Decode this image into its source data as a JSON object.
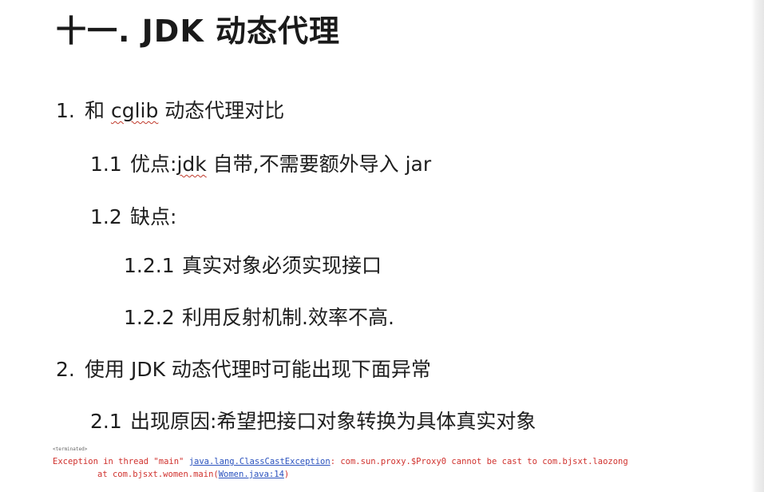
{
  "title": "十一. JDK 动态代理",
  "items": [
    {
      "num": "1.",
      "text_pre": "和 ",
      "text_squiggle": "cglib",
      "text_post": " 动态代理对比"
    },
    {
      "num": "1.1",
      "text_pre": "优点:",
      "text_squiggle": "jdk",
      "text_post": " 自带,不需要额外导入 jar"
    },
    {
      "num": "1.2",
      "text": "缺点:"
    },
    {
      "num": "1.2.1",
      "text": "真实对象必须实现接口"
    },
    {
      "num": "1.2.2",
      "text": "利用反射机制.效率不高."
    },
    {
      "num": "2.",
      "text": "使用 JDK 动态代理时可能出现下面异常"
    },
    {
      "num": "2.1",
      "text": "出现原因:希望把接口对象转换为具体真实对象"
    }
  ],
  "console": {
    "tiny_label": "&lt;terminated&gt;",
    "error_prefix": "Exception in thread \"main\" ",
    "exception_class": "java.lang.ClassCastException",
    "error_suffix": ": com.sun.proxy.$Proxy0 cannot be cast to com.bjsxt.laozong",
    "trace_prefix": "at com.bjsxt.women.main(",
    "trace_link": "Women.java:14",
    "trace_suffix": ")"
  },
  "colors": {
    "text": "#1e1e1e",
    "error_red": "#d0312d",
    "link_blue": "#2a52be",
    "squiggle_red": "#c0392b"
  }
}
